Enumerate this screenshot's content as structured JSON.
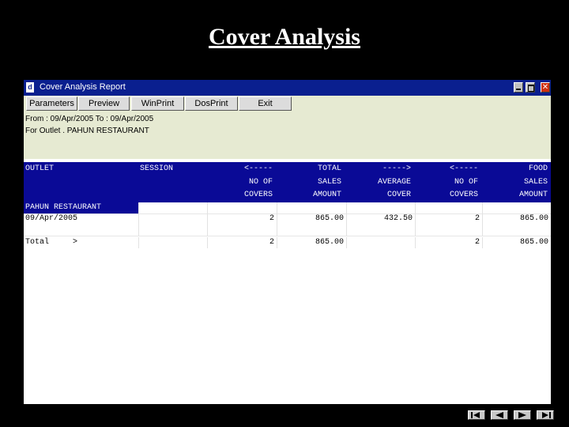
{
  "slide_title": "Cover Analysis",
  "window": {
    "title": "Cover Analysis Report",
    "app_icon": "d"
  },
  "toolbar": {
    "buttons": [
      {
        "label": "Parameters"
      },
      {
        "label": "Preview"
      },
      {
        "label": "WinPrint"
      },
      {
        "label": "DosPrint"
      },
      {
        "label": "Exit"
      }
    ]
  },
  "report_info": {
    "date_range": "From : 09/Apr/2005 To : 09/Apr/2005",
    "outlet_line": "For Outlet . PAHUN RESTAURANT"
  },
  "columns": [
    {
      "lines": [
        "OUTLET"
      ]
    },
    {
      "lines": [
        "SESSION"
      ]
    },
    {
      "lines": [
        "<-----",
        "NO OF",
        "COVERS"
      ]
    },
    {
      "lines": [
        "TOTAL",
        "SALES",
        "AMOUNT"
      ]
    },
    {
      "lines": [
        "----->",
        "AVERAGE",
        "COVER"
      ]
    },
    {
      "lines": [
        "<-----",
        "NO OF",
        "COVERS"
      ]
    },
    {
      "lines": [
        "FOOD",
        "SALES",
        "AMOUNT"
      ]
    }
  ],
  "rows": {
    "outlet_name": "PAHUN RESTAURANT",
    "detail": [
      "09/Apr/2005",
      "",
      "2",
      "865.00",
      "432.50",
      "2",
      "865.00"
    ],
    "total": [
      "Total",
      ">",
      "2",
      "865.00",
      "",
      "2",
      "865.00"
    ]
  },
  "nav_icons": [
    "first-slide-icon",
    "previous-slide-icon",
    "next-slide-icon",
    "last-slide-icon"
  ],
  "colors": {
    "titlebar": "#0a1f8f",
    "header": "#0a0a96",
    "toolbar_bg": "#e6ead2"
  }
}
